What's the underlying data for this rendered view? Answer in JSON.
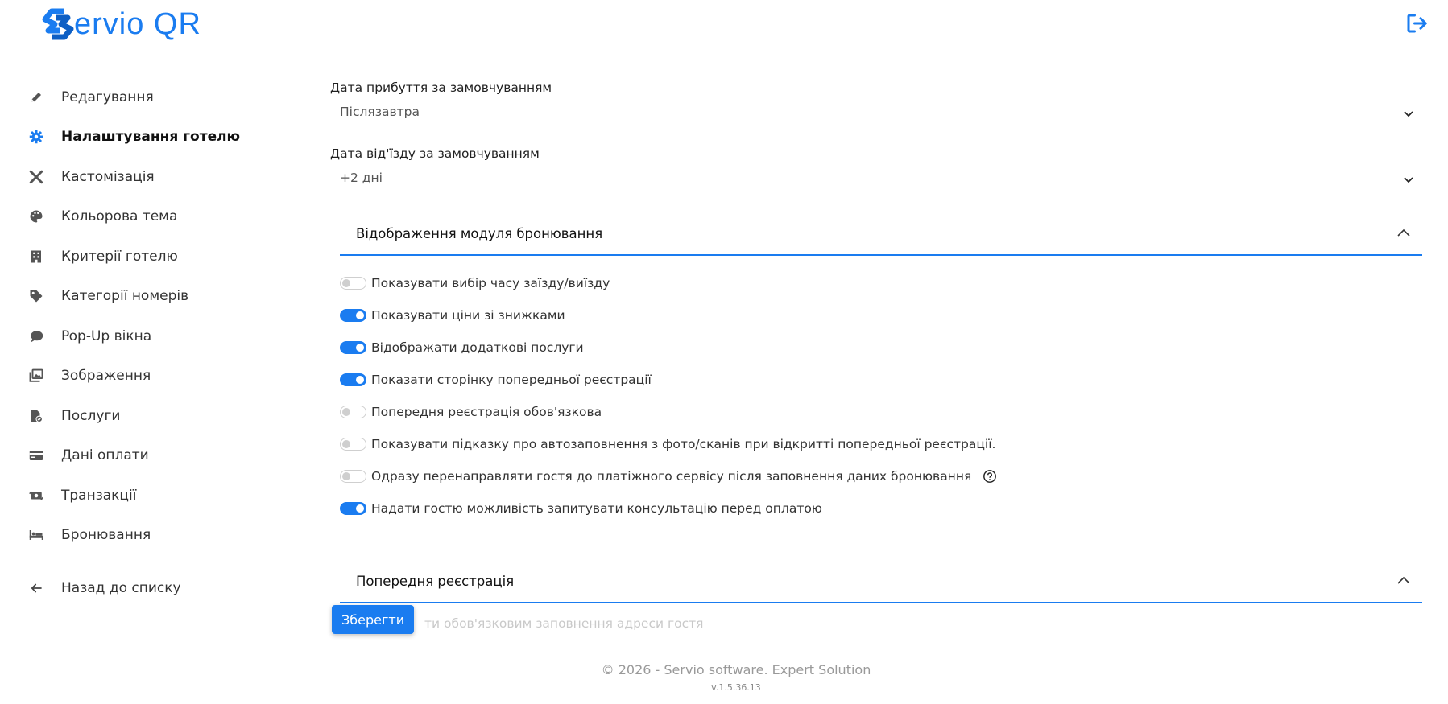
{
  "app": {
    "logo_text": "ervio QR",
    "brand_color": "#1a7cf0"
  },
  "sidebar": {
    "items": [
      {
        "label": "Редагування",
        "icon": "pencil-icon"
      },
      {
        "label": "Налаштування готелю",
        "icon": "gear-icon",
        "active": true
      },
      {
        "label": "Кастомізація",
        "icon": "tools-icon"
      },
      {
        "label": "Кольорова тема",
        "icon": "palette-icon"
      },
      {
        "label": "Критерії готелю",
        "icon": "building-icon"
      },
      {
        "label": "Категорії номерів",
        "icon": "tag-icon"
      },
      {
        "label": "Pop-Up вікна",
        "icon": "chat-icon"
      },
      {
        "label": "Зображення",
        "icon": "images-icon"
      },
      {
        "label": "Послуги",
        "icon": "file-check-icon"
      },
      {
        "label": "Дані оплати",
        "icon": "credit-card-icon"
      },
      {
        "label": "Транзакції",
        "icon": "money-exchange-icon"
      },
      {
        "label": "Бронювання",
        "icon": "bed-icon"
      }
    ],
    "back": {
      "label": "Назад до списку",
      "icon": "arrow-left-icon"
    }
  },
  "main": {
    "arrival": {
      "label": "Дата прибуття за замовчуванням",
      "value": "Післязавтра"
    },
    "departure": {
      "label": "Дата від'їзду за замовчуванням",
      "value": "+2 дні"
    },
    "booking_section": {
      "title": "Відображення модуля бронювання",
      "toggles": [
        {
          "label": "Показувати вибір часу заїзду/виїзду",
          "on": false
        },
        {
          "label": "Показувати ціни зі знижками",
          "on": true
        },
        {
          "label": "Відображати додаткові послуги",
          "on": true
        },
        {
          "label": "Показати сторінку попередньої реєстрації",
          "on": true
        },
        {
          "label": "Попередня реєстрація обов'язкова",
          "on": false
        },
        {
          "label": "Показувати підказку про автозаповнення з фото/сканів при відкритті попередньої реєстрації.",
          "on": false
        },
        {
          "label": "Одразу перенаправляти гостя до платіжного сервісу після заповнення даних бронювання",
          "on": false,
          "help": true
        },
        {
          "label": "Надати гостю можливість запитувати консультацію перед оплатою",
          "on": true
        }
      ]
    },
    "prereg_section": {
      "title": "Попередня реєстрація",
      "faded_text": "ти обов'язковим заповнення адреси гостя"
    },
    "save_label": "Зберегти"
  },
  "footer": {
    "copyright": "© 2026 - Servio software. Expert Solution",
    "version": "v.1.5.36.13"
  }
}
